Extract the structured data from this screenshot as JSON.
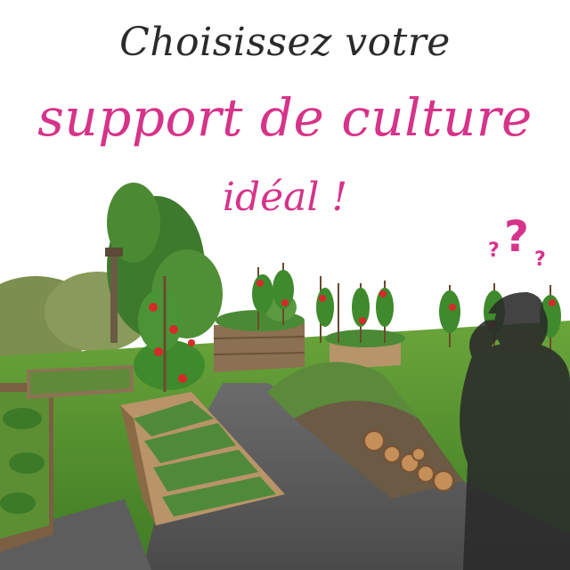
{
  "headline": {
    "line1": "Choisissez votre",
    "line2": "support de culture",
    "line3": "idéal !"
  },
  "decor": {
    "question_marks": [
      "?",
      "?",
      "?"
    ]
  },
  "colors": {
    "title_dark": "#2b2b2b",
    "title_pink": "#d6338a",
    "grass": "#4f8f2e",
    "gravel": "#5a5a5a",
    "wood": "#9a7a55",
    "silhouette": "#2a2a2a"
  },
  "icons": {
    "person": "person-thinking-silhouette-icon",
    "question": "question-marks-icon"
  }
}
